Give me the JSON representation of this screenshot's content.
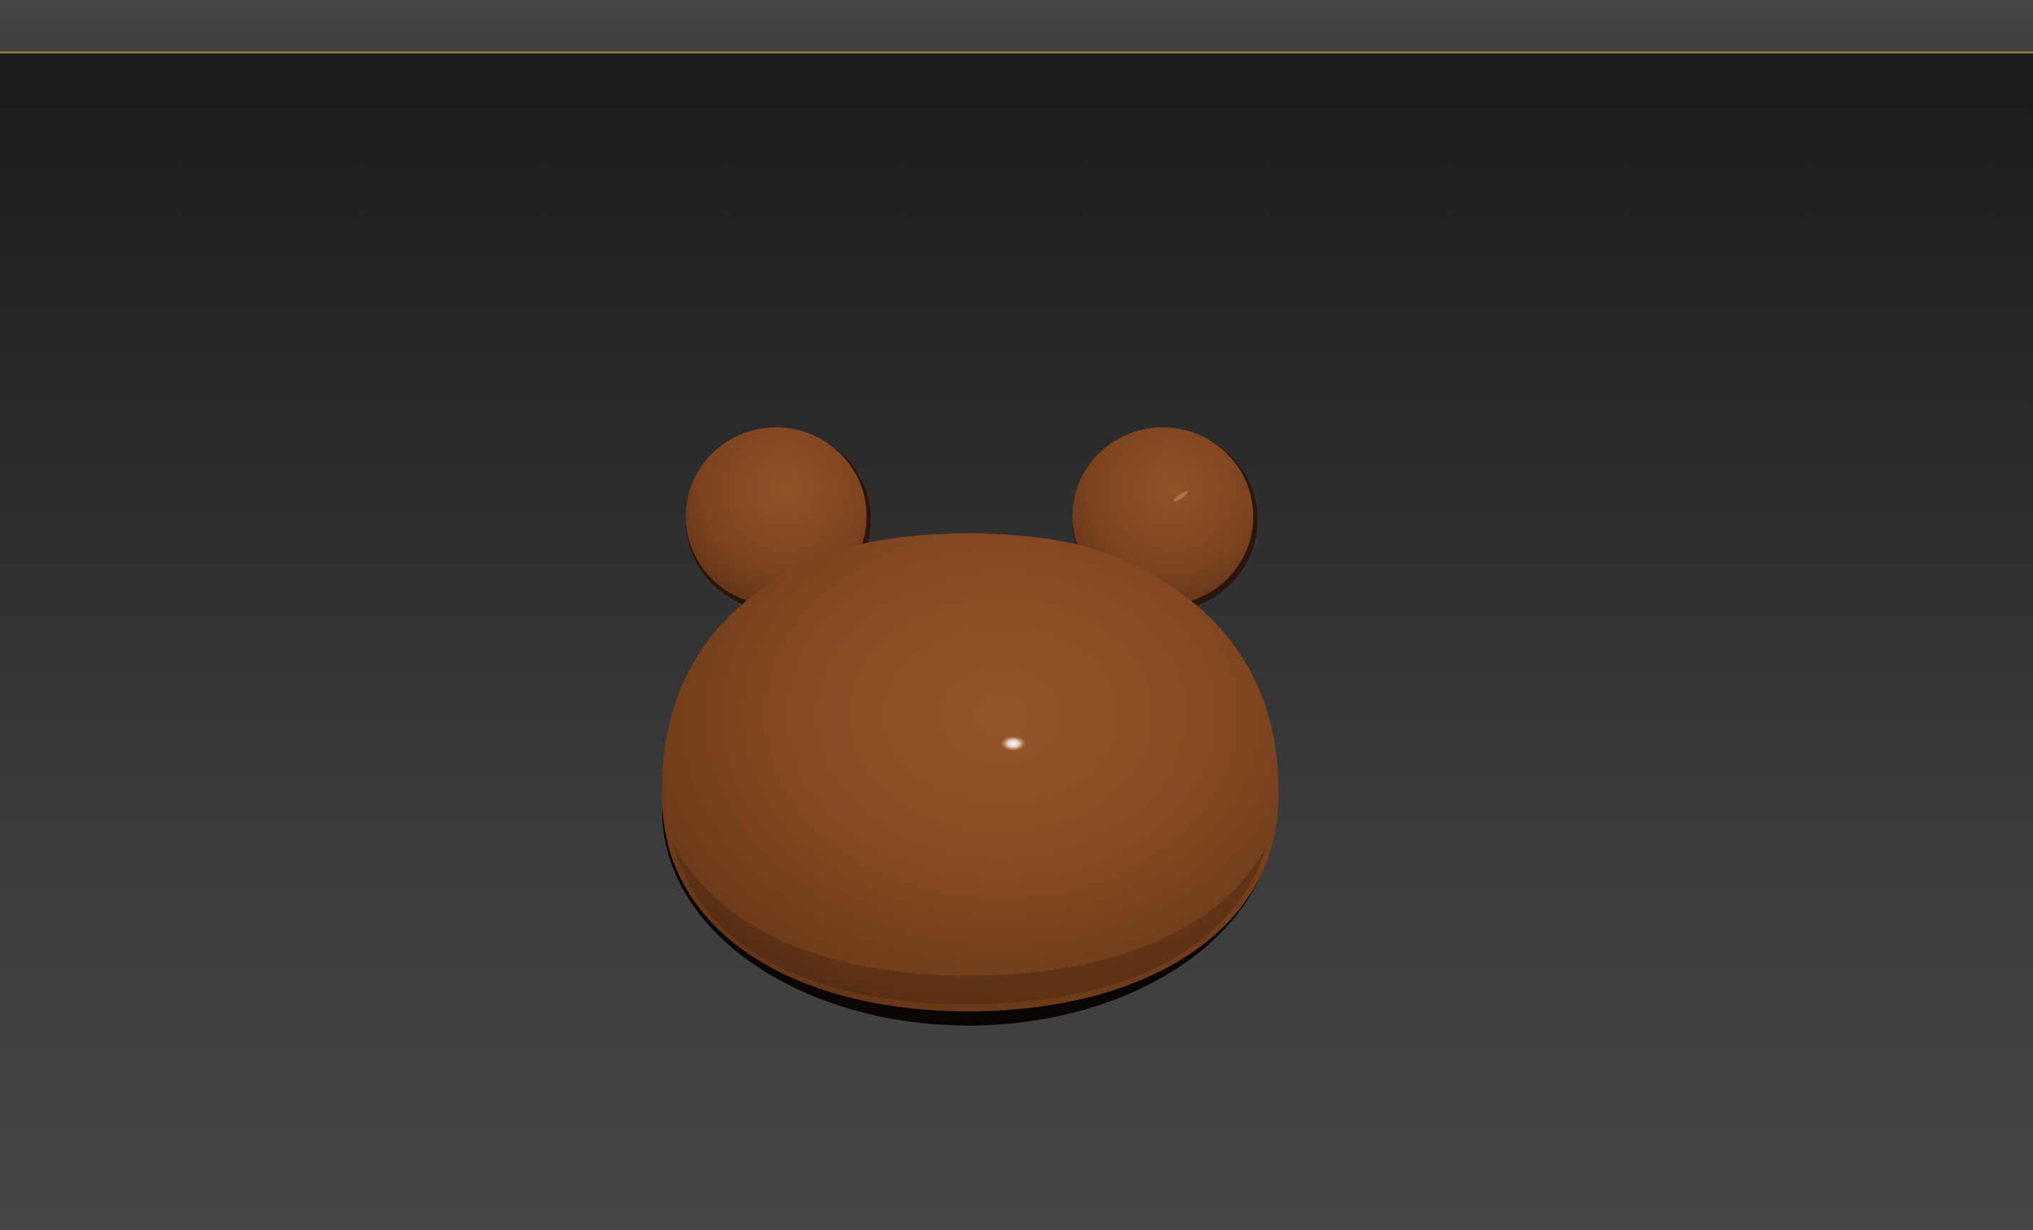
{
  "viewport": {
    "label": "3d-perspective-viewport",
    "background_top": "#1b1b1b",
    "background_bottom": "#464646",
    "active_border_color": "#9a8a3c"
  },
  "model": {
    "object": "bear-head-mesh",
    "material_color": "#8a4b24",
    "highlight_color": "#ffffff"
  }
}
